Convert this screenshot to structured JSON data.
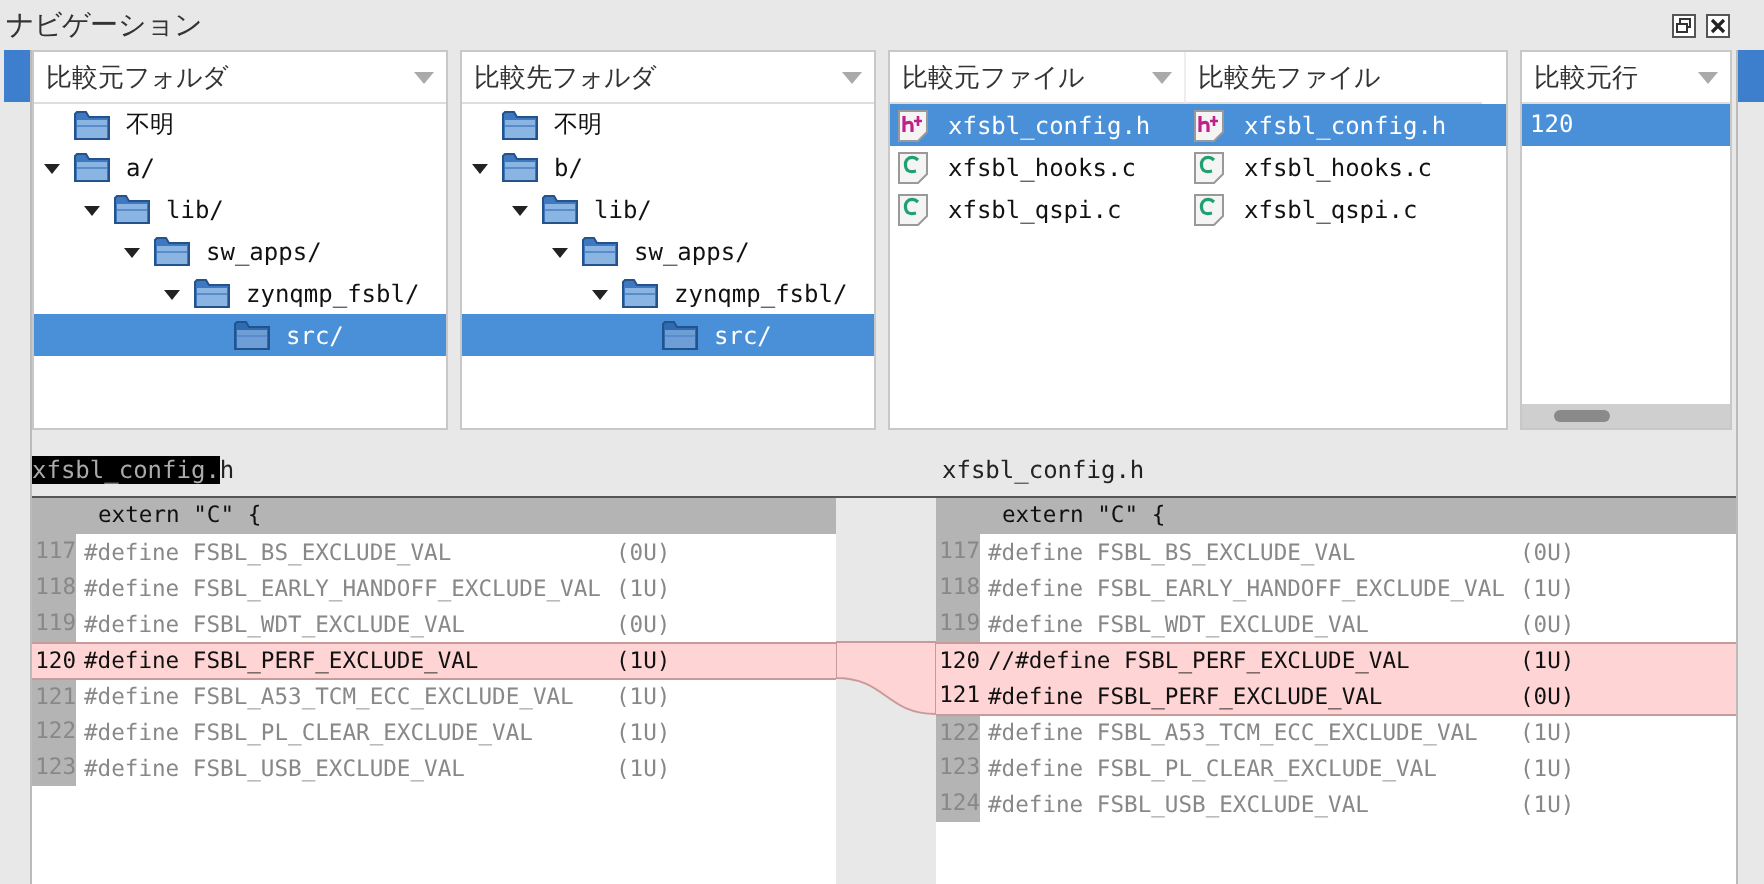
{
  "window": {
    "title": "ナビゲーション"
  },
  "source_folders": {
    "header": "比較元フォルダ",
    "tree": [
      {
        "label": "不明",
        "selected": false
      },
      {
        "label": "a/",
        "expanded": true,
        "selected": false,
        "children": [
          {
            "label": "lib/",
            "expanded": true,
            "selected": false,
            "children": [
              {
                "label": "sw_apps/",
                "expanded": true,
                "selected": false,
                "children": [
                  {
                    "label": "zynqmp_fsbl/",
                    "expanded": true,
                    "selected": false,
                    "children": [
                      {
                        "label": "src/",
                        "selected": true
                      }
                    ]
                  }
                ]
              }
            ]
          }
        ]
      }
    ]
  },
  "target_folders": {
    "header": "比較先フォルダ",
    "tree": [
      {
        "label": "不明",
        "selected": false
      },
      {
        "label": "b/",
        "expanded": true,
        "selected": false,
        "children": [
          {
            "label": "lib/",
            "expanded": true,
            "selected": false,
            "children": [
              {
                "label": "sw_apps/",
                "expanded": true,
                "selected": false,
                "children": [
                  {
                    "label": "zynqmp_fsbl/",
                    "expanded": true,
                    "selected": false,
                    "children": [
                      {
                        "label": "src/",
                        "selected": true
                      }
                    ]
                  }
                ]
              }
            ]
          }
        ]
      }
    ]
  },
  "files": {
    "columns": [
      "比較元ファイル",
      "比較先ファイル"
    ],
    "rows": [
      {
        "kind": "header",
        "source": "xfsbl_config.h",
        "target": "xfsbl_config.h",
        "selected": true
      },
      {
        "kind": "source",
        "source": "xfsbl_hooks.c",
        "target": "xfsbl_hooks.c",
        "selected": false
      },
      {
        "kind": "source",
        "source": "xfsbl_qspi.c",
        "target": "xfsbl_qspi.c",
        "selected": false
      }
    ]
  },
  "lines_table": {
    "column": "比較元行",
    "rows": [
      {
        "value": "120",
        "selected": true
      }
    ]
  },
  "left_pane": {
    "file_selected_part": "xfsbl_config.",
    "file_rest": "h",
    "context": "extern \"C\" {",
    "lines": [
      {
        "num": "117",
        "code": "#define FSBL_BS_EXCLUDE_VAL",
        "value": "(0U)",
        "changed": false
      },
      {
        "num": "118",
        "code": "#define FSBL_EARLY_HANDOFF_EXCLUDE_VAL",
        "value": "(1U)",
        "changed": false
      },
      {
        "num": "119",
        "code": "#define FSBL_WDT_EXCLUDE_VAL",
        "value": "(0U)",
        "changed": false
      },
      {
        "num": "120",
        "code": "#define FSBL_PERF_EXCLUDE_VAL",
        "value": "(1U)",
        "changed": true
      },
      {
        "num": "121",
        "code": "#define FSBL_A53_TCM_ECC_EXCLUDE_VAL",
        "value": "(1U)",
        "changed": false
      },
      {
        "num": "122",
        "code": "#define FSBL_PL_CLEAR_EXCLUDE_VAL",
        "value": "(1U)",
        "changed": false
      },
      {
        "num": "123",
        "code": "#define FSBL_USB_EXCLUDE_VAL",
        "value": "(1U)",
        "changed": false
      }
    ]
  },
  "right_pane": {
    "file_rest": "xfsbl_config.h",
    "context": "extern \"C\" {",
    "lines": [
      {
        "num": "117",
        "code": "#define FSBL_BS_EXCLUDE_VAL",
        "value": "(0U)",
        "changed": false
      },
      {
        "num": "118",
        "code": "#define FSBL_EARLY_HANDOFF_EXCLUDE_VAL",
        "value": "(1U)",
        "changed": false
      },
      {
        "num": "119",
        "code": "#define FSBL_WDT_EXCLUDE_VAL",
        "value": "(0U)",
        "changed": false
      },
      {
        "num": "120",
        "code": "//#define FSBL_PERF_EXCLUDE_VAL",
        "value": "(1U)",
        "changed": true
      },
      {
        "num": "121",
        "code": "#define FSBL_PERF_EXCLUDE_VAL",
        "value": "(0U)",
        "changed": true
      },
      {
        "num": "122",
        "code": "#define FSBL_A53_TCM_ECC_EXCLUDE_VAL",
        "value": "(1U)",
        "changed": false
      },
      {
        "num": "123",
        "code": "#define FSBL_PL_CLEAR_EXCLUDE_VAL",
        "value": "(1U)",
        "changed": false
      },
      {
        "num": "124",
        "code": "#define FSBL_USB_EXCLUDE_VAL",
        "value": "(1U)",
        "changed": false
      }
    ]
  }
}
